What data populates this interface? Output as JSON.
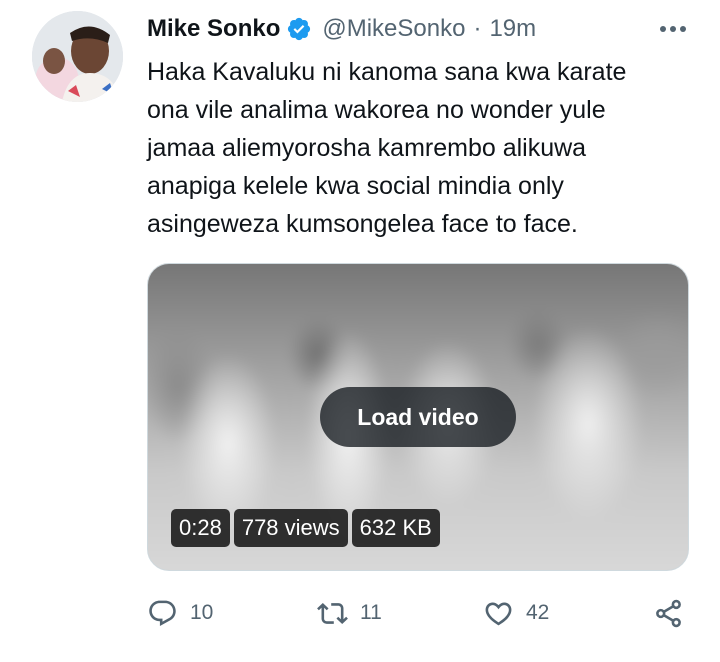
{
  "tweet": {
    "author_name": "Mike Sonko",
    "handle": "@MikeSonko",
    "separator": "·",
    "time": "19m",
    "text_lines": [
      "Haka Kavaluku ni kanoma sana kwa karate",
      "ona vile analima wakorea no wonder yule",
      "jamaa aliemyorosha kamrembo alikuwa",
      "anapiga kelele kwa social mindia only",
      "asingeweza kumsongelea face to face."
    ]
  },
  "media": {
    "load_label": "Load video",
    "duration": "0:28",
    "views": "778 views",
    "size": "632 KB"
  },
  "actions": {
    "reply_count": "10",
    "retweet_count": "11",
    "like_count": "42"
  },
  "colors": {
    "verified_blue": "#1d9bf0",
    "secondary_text": "#536471",
    "primary_text": "#0f1419"
  },
  "icons": [
    "verified-badge-icon",
    "more-options-icon",
    "reply-icon",
    "retweet-icon",
    "like-icon",
    "share-icon"
  ]
}
